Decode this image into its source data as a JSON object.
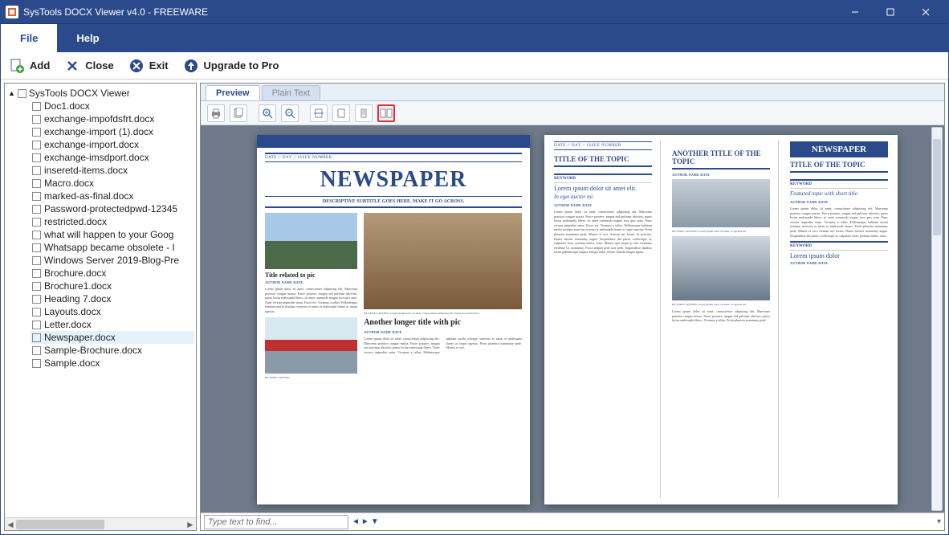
{
  "window": {
    "title": "SysTools DOCX Viewer v4.0 - FREEWARE"
  },
  "menu": {
    "items": [
      "File",
      "Help"
    ],
    "active": "File"
  },
  "toolbar": {
    "add": "Add",
    "close": "Close",
    "exit": "Exit",
    "upgrade": "Upgrade to Pro"
  },
  "tree": {
    "root": "SysTools DOCX Viewer",
    "selected": "Newspaper.docx",
    "items": [
      "Doc1.docx",
      "exchange-impofdsfrt.docx",
      "exchange-import (1).docx",
      "exchange-import.docx",
      "exchange-imsdport.docx",
      "inseretd-items.docx",
      "Macro.docx",
      "marked-as-final.docx",
      "Password-protectedpwd-12345",
      "restricted.docx",
      "what will happen to your Goog",
      "Whatsapp became obsolete - I",
      "Windows Server 2019-Blog-Pre",
      "Brochure.docx",
      "Brochure1.docx",
      "Heading 7.docx",
      "Layouts.docx",
      "Letter.docx",
      "Newspaper.docx",
      "Sample-Brochure.docx",
      "Sample.docx"
    ]
  },
  "preview": {
    "tabs": {
      "preview": "Preview",
      "plain": "Plain Text"
    },
    "find_placeholder": "Type text to find..."
  },
  "doc": {
    "page1": {
      "meta": "DATE  //  DAY  //  ISSUE NUMBER",
      "title": "NEWSPAPER",
      "subtitle": "DESCRIPTIVE SUBTITLE GOES HERE.  MAKE IT GO ACROSS.",
      "col1": {
        "h": "Title related to pic",
        "byline": "AUTHOR NAME\nDATE",
        "body": "Lorem ipsum dolor sit amet, consectetuer adipiscing elit. Maecenas porttitor congue massa. Fusce posuere, magna sed pulvinar ultricies, purus lectus malesuada libero, sit amet commodo magna eros quis urna. Nunc viverra imperdiet enim. Fusce est. Vivamus a tellus. Pellentesque habitant morbi tristique senectus et netus et malesuada fames ac turpis egestas.",
        "cap": "PICTURE CAPTION"
      },
      "col2": {
        "cap": "PICTURE CAPTION. Lorem ipsum dolor sit amet, consectetuer adipiscing elit. Fusce sed lorem vitae.",
        "h": "Another longer title with pic",
        "byline": "AUTHOR NAME\nDATE",
        "body": "Lorem ipsum dolor sit amet, consectetuer adipiscing elit. Maecenas porttitor congue massa. Fusce posuere, magna sed pulvinar ultricies, purus lectus malesuada libero. Nunc viverra imperdiet enim. Vivamus a tellus. Pellentesque habitant morbi tristique senectus et netus et malesuada fames ac turpis egestas. Proin pharetra nonummy pede. Mauris et orci."
      }
    },
    "page2": {
      "meta": "DATE  //  DAY  //  ISSUE NUMBER",
      "brand": "NEWSPAPER",
      "col1": {
        "section": "TITLE OF THE TOPIC",
        "kw": "KEYWORD",
        "lead": "Lorem ipsum dolor sit amet elit.",
        "leadi": "In eget auctor mi.",
        "byline": "AUTHOR NAME\nDATE",
        "body": "Lorem ipsum dolor sit amet, consectetuer adipiscing elit. Maecenas porttitor congue massa. Fusce posuere, magna sed pulvinar ultricies, purus lectus malesuada libero, sit amet commodo magna eros quis urna. Nunc viverra imperdiet enim. Fusce est. Vivamus a tellus. Pellentesque habitant morbi tristique senectus et netus et malesuada fames ac turpis egestas. Proin pharetra nonummy pede. Mauris et orci. Aenean nec lorem. In porttitor. Donec laoreet nonummy augue. Suspendisse dui purus, scelerisque at, vulputate vitae, pretium mattis, nunc. Mauris eget neque at sem venenatis eleifend. Ut nonummy. Fusce aliquet pede non pede. Suspendisse dapibus lorem pellentesque magna. Integer nulla. Donec blandit feugiat ligula."
      },
      "col2": {
        "section": "ANOTHER TITLE OF THE TOPIC",
        "byline": "AUTHOR NAME\nDATE",
        "cap": "PICTURE CAPTION. Lorem ipsum dolor sit amet, ac egestas mi.",
        "body": "Lorem ipsum dolor sit amet, consectetuer adipiscing elit. Maecenas porttitor congue massa. Fusce posuere, magna sed pulvinar ultricies, purus lectus malesuada libero. Vivamus a tellus. Proin pharetra nonummy pede."
      },
      "col3": {
        "section": "TITLE OF THE TOPIC",
        "kw": "KEYWORD",
        "lead": "Featured topic with short title.",
        "byline": "AUTHOR NAME\nDATE",
        "body": "Lorem ipsum dolor sit amet, consectetuer adipiscing elit. Maecenas porttitor congue massa. Fusce posuere, magna sed pulvinar ultricies, purus lectus malesuada libero, sit amet commodo magna eros quis urna. Nunc viverra imperdiet enim. Vivamus a tellus. Pellentesque habitant morbi tristique senectus et netus et malesuada fames. Proin pharetra nonummy pede. Mauris et orci. Aenean nec lorem. Donec laoreet nonummy augue. Suspendisse dui purus, scelerisque at, vulputate vitae, pretium mattis, nunc.",
        "kw2": "KEYWORD",
        "lead2": "Lorem ipsum dolor",
        "byline2": "AUTHOR NAME\nDATE"
      }
    }
  }
}
